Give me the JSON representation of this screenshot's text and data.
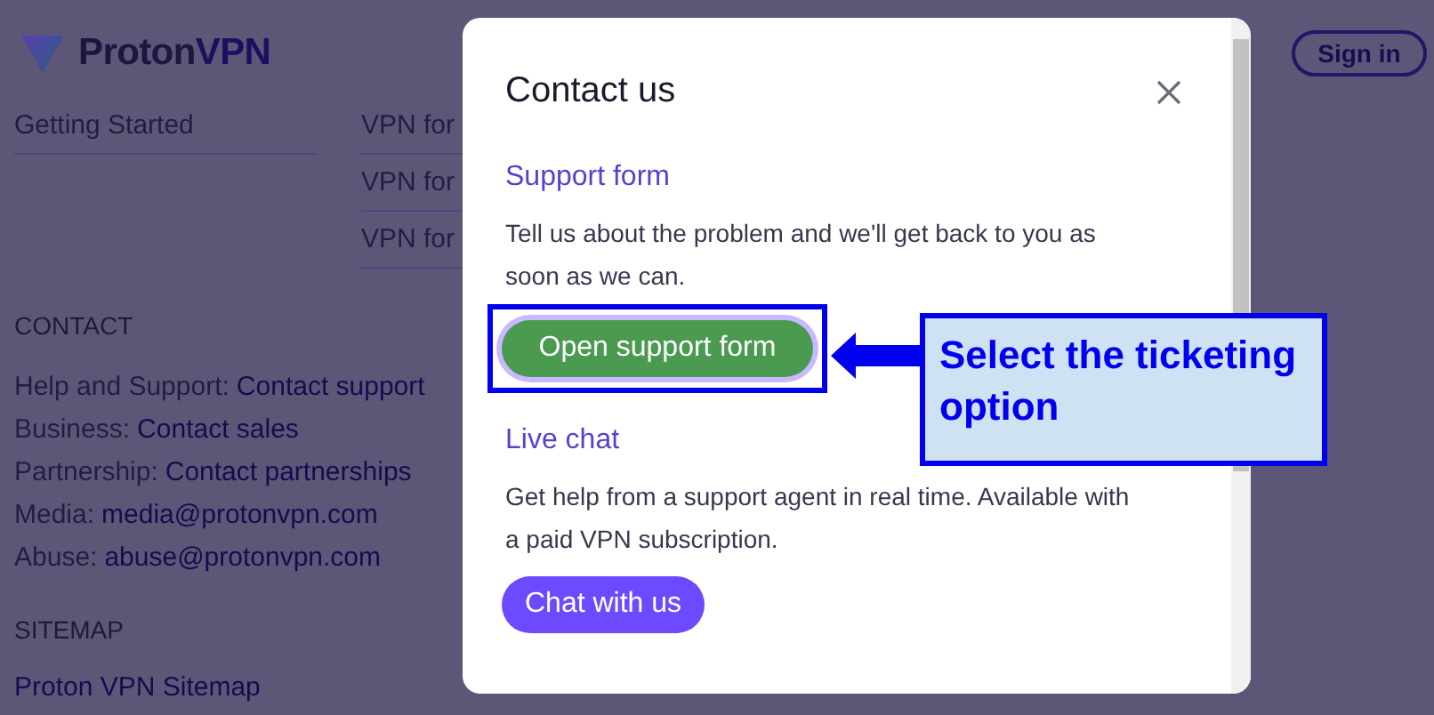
{
  "logo": {
    "text": "Proton",
    "accent": "VPN"
  },
  "header": {
    "sign_in": "Sign in"
  },
  "footer": {
    "left_links": [
      "Getting Started"
    ],
    "mid_links": [
      "VPN for",
      "VPN for",
      "VPN for"
    ],
    "contact": {
      "heading": "CONTACT",
      "lines": [
        {
          "label": "Help and Support:",
          "link": "Contact support"
        },
        {
          "label": "Business:",
          "link": "Contact sales"
        },
        {
          "label": "Partnership:",
          "link": "Contact partnerships"
        },
        {
          "label": "Media:",
          "link": "media@protonvpn.com"
        },
        {
          "label": "Abuse:",
          "link": "abuse@protonvpn.com"
        }
      ]
    },
    "sitemap": {
      "heading": "SITEMAP",
      "links": [
        "Proton VPN Sitemap"
      ]
    }
  },
  "modal": {
    "title": "Contact us",
    "sections": [
      {
        "kind": "support",
        "heading": "Support form",
        "text": "Tell us about the problem and we'll get back to you as soon as we can.",
        "button": "Open support form",
        "highlighted": true
      },
      {
        "kind": "chat",
        "heading": "Live chat",
        "text": "Get help from a support agent in real time. Available with a paid VPN subscription.",
        "button": "Chat with us",
        "highlighted": false
      }
    ]
  },
  "annotation": {
    "text": "Select the ticketing option"
  }
}
